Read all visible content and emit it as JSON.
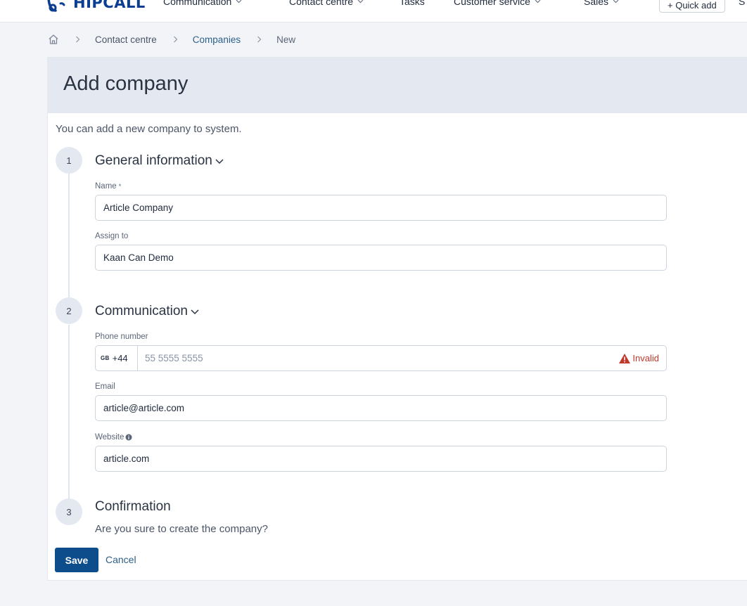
{
  "header": {
    "brand": "HIPCALL",
    "nav": [
      {
        "label": "Communication",
        "dropdown": true
      },
      {
        "label": "Contact centre",
        "dropdown": true
      },
      {
        "label": "Tasks",
        "dropdown": false
      },
      {
        "label": "Customer service",
        "dropdown": true
      },
      {
        "label": "Sales",
        "dropdown": true
      }
    ],
    "quick_add": "+ Quick add",
    "trailing": "S"
  },
  "breadcrumb": {
    "items": [
      "Contact centre",
      "Companies",
      "New"
    ]
  },
  "page": {
    "title": "Add company",
    "subtitle": "You can add a new company to system."
  },
  "steps": [
    {
      "number": "1",
      "title": "General information",
      "fields": {
        "name": {
          "label": "Name",
          "required_mark": "*",
          "value": "Article Company"
        },
        "assign_to": {
          "label": "Assign to",
          "value": "Kaan Can Demo"
        }
      }
    },
    {
      "number": "2",
      "title": "Communication",
      "fields": {
        "phone": {
          "label": "Phone number",
          "country_code": "GB",
          "dial_code": "+44",
          "value": "",
          "placeholder": "55 5555 5555",
          "error": "Invalid"
        },
        "email": {
          "label": "Email",
          "value": "article@article.com"
        },
        "website": {
          "label": "Website",
          "value": "article.com"
        }
      }
    },
    {
      "number": "3",
      "title": "Confirmation",
      "text": "Are you sure to create the company?"
    }
  ],
  "actions": {
    "save": "Save",
    "cancel": "Cancel"
  },
  "colors": {
    "primary": "#0d4d8c",
    "brand": "#0b3d91",
    "error": "#c0392b",
    "header_band": "#e4e9f1"
  }
}
